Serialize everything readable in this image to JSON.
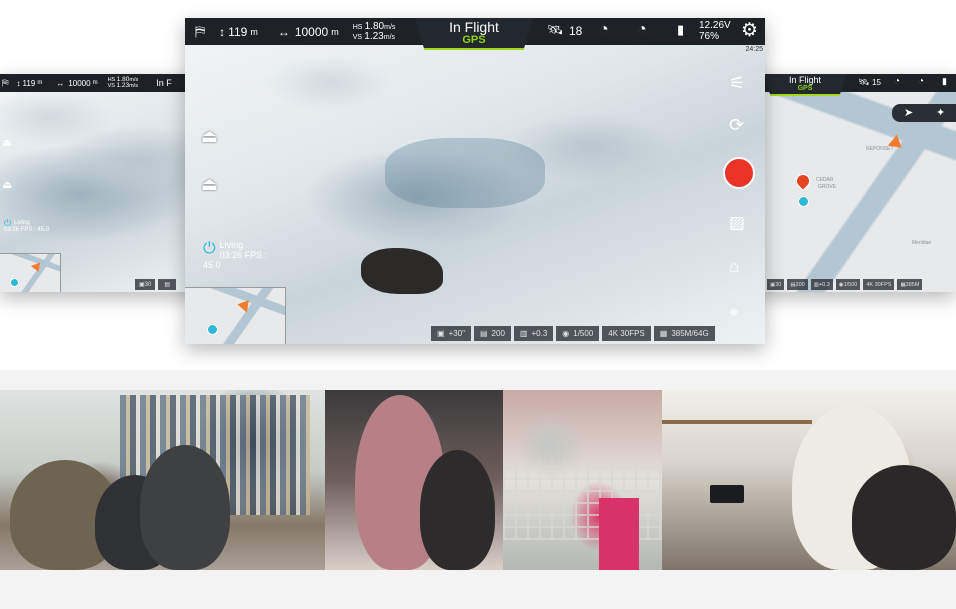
{
  "main_ui": {
    "altitude": "119",
    "altitude_unit": "m",
    "distance": "10000",
    "distance_unit": "m",
    "hs_label": "HS",
    "hs_value": "1.80",
    "hs_unit": "m/s",
    "vs_label": "VS",
    "vs_value": "1.23",
    "vs_unit": "m/s",
    "flight_status": "In  Flight",
    "positioning": "GPS",
    "satellites": "18",
    "voltage": "12.26V",
    "battery": "76%",
    "clock": "24:25",
    "living_label": "Living",
    "living_stats": "03:26  FPS : 45.0",
    "camera": {
      "ev": "+30\"",
      "iso": "200",
      "exposure": "+0.3",
      "shutter": "1/500",
      "resolution": "4K 30FPS",
      "storage": "385M/64G"
    }
  },
  "left_ui": {
    "altitude": "119",
    "altitude_unit": "m",
    "distance": "10000",
    "distance_unit": "m",
    "hs_label": "HS",
    "hs_value": "1.80",
    "hs_unit": "m/s",
    "vs_label": "VS",
    "vs_value": "1.23",
    "vs_unit": "m/s",
    "flight_status": "In  F",
    "living_label": "Living",
    "living_stats": "03:26  FPS : 45.0",
    "cell1": "30",
    "cell2": ""
  },
  "right_ui": {
    "flight_status": "In Flight",
    "positioning": "GPS",
    "satellites": "15",
    "place1": "NEPONSET",
    "place2": "CEDAR",
    "place3": "GROVE",
    "place4": "Meridian",
    "cells": [
      "30",
      "200",
      "+0.3",
      "1/500",
      "4K 30FPS",
      "385M"
    ]
  },
  "colors": {
    "accent_green": "#8fd114",
    "record_red": "#ea3326",
    "marker_orange": "#f27b2e",
    "marker_blue": "#2fb7d6",
    "bar_dark": "#1e2227"
  },
  "icons": {
    "no_fly": "no-fly-icon",
    "altitude": "altitude-arrow-icon",
    "distance": "distance-arrow-icon",
    "satellite": "satellite-icon",
    "rc_signal": "rc-signal-icon",
    "image_signal": "image-signal-icon",
    "battery": "battery-icon",
    "settings": "gear-icon"
  }
}
